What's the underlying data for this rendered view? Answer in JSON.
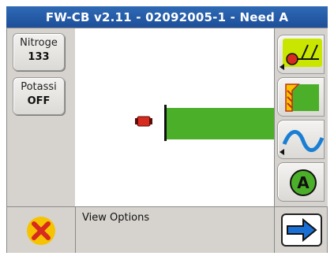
{
  "title": "FW-CB v2.11 - 02092005-1 - Need A",
  "left_panel": {
    "items": [
      {
        "label": "Nitroge",
        "value": "133"
      },
      {
        "label": "Potassi",
        "value": "OFF"
      }
    ]
  },
  "right_panel": {
    "buttons": [
      {
        "icon": "tool-implement-icon"
      },
      {
        "icon": "field-boundary-icon"
      },
      {
        "icon": "guidance-wave-icon"
      },
      {
        "icon": "a-button-icon"
      }
    ]
  },
  "status": {
    "text": "View Options"
  },
  "colors": {
    "title_bg": "#2f6ab5",
    "panel_bg": "#d6d3ce",
    "coverage_green": "#4caf2a",
    "accent_yellow": "#f6c300",
    "cancel_red": "#d62b1e"
  }
}
